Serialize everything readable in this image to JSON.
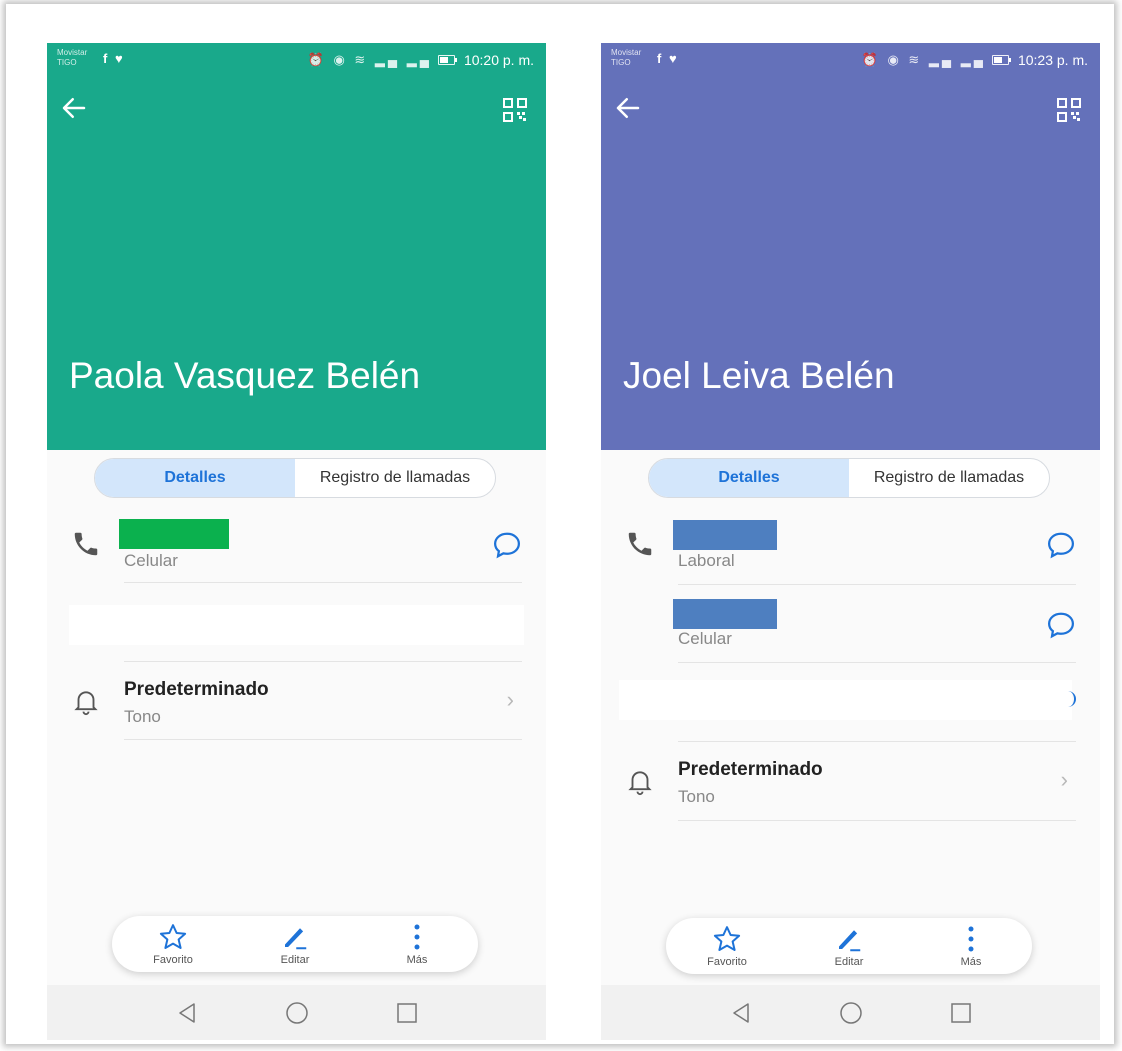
{
  "colors": {
    "left_header": "#19a98b",
    "right_header": "#6471ba",
    "accent": "#1e73d8",
    "redact_left": "#0bb14e",
    "redact_right": "#4e7fc0"
  },
  "left": {
    "status": {
      "carrier_line1": "Movistar",
      "carrier_line2": "TIGO",
      "social": "f ♥",
      "time": "10:20 p. m."
    },
    "contact_name": "Paola Vasquez Belén",
    "tabs": {
      "details": "Detalles",
      "call_log": "Registro de llamadas"
    },
    "phone_label": "Celular",
    "ringtone_title": "Predeterminado",
    "ringtone_sub": "Tono",
    "actions": {
      "favorite": "Favorito",
      "edit": "Editar",
      "more": "Más"
    }
  },
  "right": {
    "status": {
      "carrier_line1": "Movistar",
      "carrier_line2": "TIGO",
      "social": "f ♥",
      "time": "10:23 p. m."
    },
    "contact_name": "Joel Leiva Belén",
    "tabs": {
      "details": "Detalles",
      "call_log": "Registro de llamadas"
    },
    "phone_label_1": "Laboral",
    "phone_label_2": "Celular",
    "ringtone_title": "Predeterminado",
    "ringtone_sub": "Tono",
    "actions": {
      "favorite": "Favorito",
      "edit": "Editar",
      "more": "Más"
    }
  }
}
